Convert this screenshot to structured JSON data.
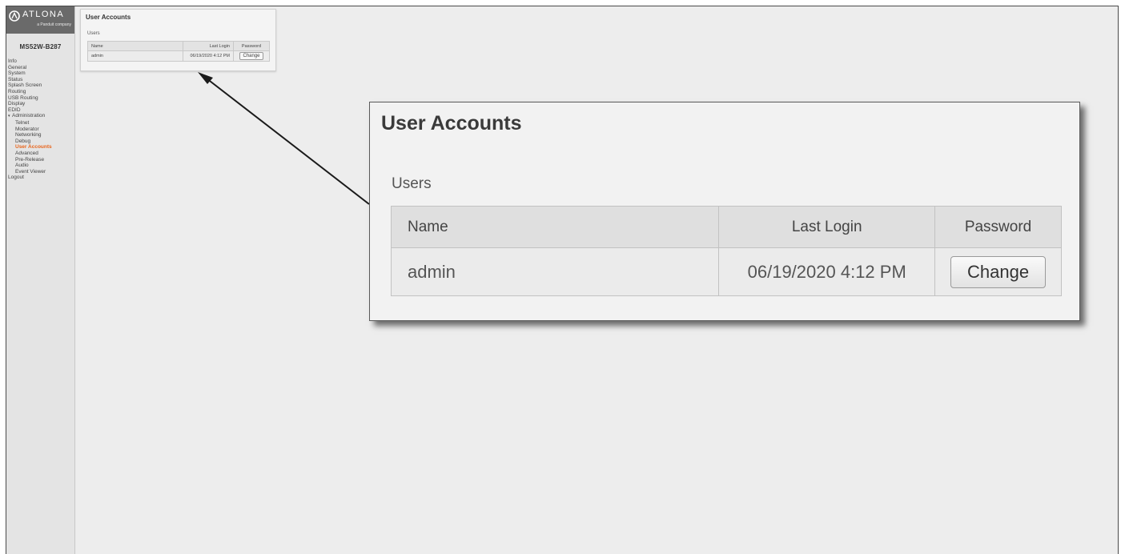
{
  "brand": {
    "name": "ATLONA",
    "tagline": "a Panduit company"
  },
  "device": {
    "name": "MS52W-B287"
  },
  "nav": [
    {
      "label": "Info",
      "sub": false,
      "active": false
    },
    {
      "label": "General",
      "sub": false,
      "active": false
    },
    {
      "label": "System",
      "sub": false,
      "active": false
    },
    {
      "label": "Status",
      "sub": false,
      "active": false
    },
    {
      "label": "Splash Screen",
      "sub": false,
      "active": false
    },
    {
      "label": "Routing",
      "sub": false,
      "active": false
    },
    {
      "label": "USB Routing",
      "sub": false,
      "active": false
    },
    {
      "label": "Display",
      "sub": false,
      "active": false
    },
    {
      "label": "EDID",
      "sub": false,
      "active": false
    },
    {
      "label": "Administration",
      "sub": false,
      "active": false,
      "expanded": true
    },
    {
      "label": "Telnet",
      "sub": true,
      "active": false
    },
    {
      "label": "Moderator",
      "sub": true,
      "active": false
    },
    {
      "label": "Networking",
      "sub": true,
      "active": false
    },
    {
      "label": "Debug",
      "sub": true,
      "active": false
    },
    {
      "label": "User Accounts",
      "sub": true,
      "active": true
    },
    {
      "label": "Advanced",
      "sub": true,
      "active": false
    },
    {
      "label": "Pre-Release",
      "sub": true,
      "active": false
    },
    {
      "label": "Audio",
      "sub": true,
      "active": false
    },
    {
      "label": "Event Viewer",
      "sub": true,
      "active": false
    },
    {
      "label": "Logout",
      "sub": false,
      "active": false
    }
  ],
  "page": {
    "title": "User Accounts",
    "section": "Users",
    "columns": {
      "name": "Name",
      "last_login": "Last Login",
      "password": "Password"
    },
    "rows": [
      {
        "name": "admin",
        "last_login": "06/19/2020 4:12 PM",
        "action": "Change"
      }
    ]
  },
  "colors": {
    "active_nav": "#e8651c",
    "logo_bg": "#6a6a6a"
  }
}
